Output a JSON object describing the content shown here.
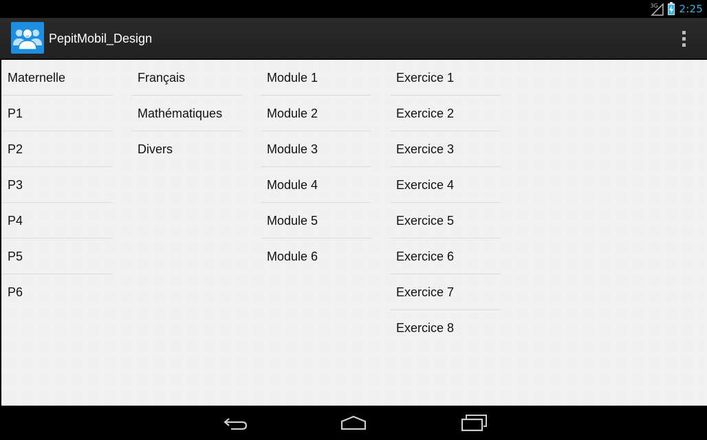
{
  "status_bar": {
    "network_type": "3G",
    "time": "2:25",
    "icons": [
      "signal-icon",
      "battery-charging-icon"
    ]
  },
  "action_bar": {
    "app_icon": "people-group-icon",
    "title": "PepitMobil_Design",
    "overflow_icon": "overflow-menu-icon"
  },
  "columns": [
    {
      "name": "levels",
      "items": [
        "Maternelle",
        "P1",
        "P2",
        "P3",
        "P4",
        "P5",
        "P6"
      ]
    },
    {
      "name": "subjects",
      "items": [
        "Français",
        "Mathématiques",
        "Divers"
      ]
    },
    {
      "name": "modules",
      "items": [
        "Module 1",
        "Module 2",
        "Module 3",
        "Module 4",
        "Module 5",
        "Module 6"
      ]
    },
    {
      "name": "exercises",
      "items": [
        "Exercice 1",
        "Exercice 2",
        "Exercice 3",
        "Exercice 4",
        "Exercice 5",
        "Exercice 6",
        "Exercice 7",
        "Exercice 8"
      ]
    }
  ],
  "nav_bar": {
    "buttons": [
      "back-icon",
      "home-icon",
      "recent-apps-icon"
    ]
  },
  "colors": {
    "accent": "#33b5e5",
    "app_icon_bg": "#1e8fe0",
    "action_bar_bg": "#222222",
    "content_bg": "#f3f3f3",
    "divider": "#dcdcdc"
  }
}
